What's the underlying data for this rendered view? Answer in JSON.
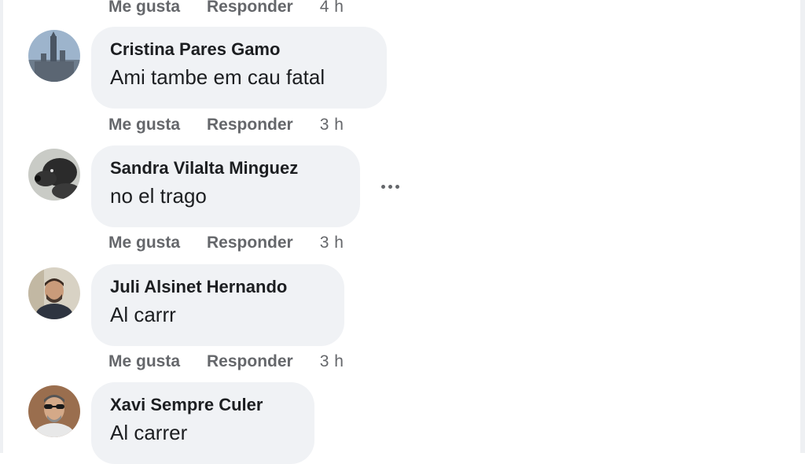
{
  "actions": {
    "like_label": "Me gusta",
    "reply_label": "Responder"
  },
  "comments": [
    {
      "author": "",
      "text": "",
      "time": "4 h"
    },
    {
      "author": "Cristina Pares Gamo",
      "text": "Ami tambe em cau fatal",
      "time": "3 h",
      "avatar": "cityscape-photo"
    },
    {
      "author": "Sandra Vilalta Minguez",
      "text": "no el trago",
      "time": "3 h",
      "avatar": "dog-photo",
      "has_more_options": true
    },
    {
      "author": "Juli Alsinet Hernando",
      "text": "Al carrr",
      "time": "3 h",
      "avatar": "man-portrait-photo"
    },
    {
      "author": "Xavi Sempre Culer",
      "text": "Al carrer",
      "time": "",
      "avatar": "man-sunglasses-photo"
    }
  ],
  "colors": {
    "bubble": "#f0f2f5",
    "meta_text": "#65676b",
    "text": "#1c1e21"
  },
  "icons": {
    "more": "more-options-icon"
  }
}
